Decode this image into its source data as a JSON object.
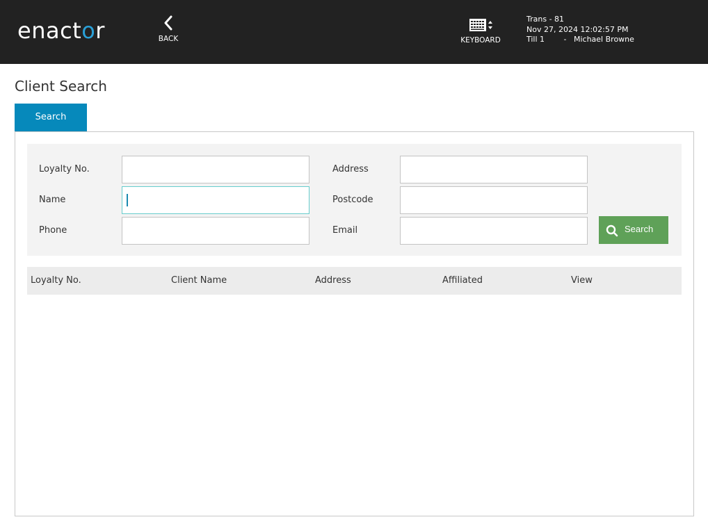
{
  "header": {
    "logo_text": "enactor",
    "back_label": "BACK",
    "keyboard_label": "KEYBOARD",
    "transaction": "Trans - 81",
    "datetime": "Nov 27, 2024 12:02:57 PM",
    "till": "Till 1",
    "separator": "-",
    "operator": "Michael Browne"
  },
  "page": {
    "title": "Client Search",
    "tabs": [
      {
        "label": "Search",
        "active": true
      }
    ]
  },
  "form": {
    "fields": [
      {
        "label": "Loyalty No.",
        "value": ""
      },
      {
        "label": "Name",
        "value": "",
        "focused": true
      },
      {
        "label": "Phone",
        "value": ""
      },
      {
        "label": "Address",
        "value": ""
      },
      {
        "label": "Postcode",
        "value": ""
      },
      {
        "label": "Email",
        "value": ""
      }
    ],
    "search_button_label": "Search"
  },
  "results_table": {
    "columns": [
      "Loyalty No.",
      "Client Name",
      "Address",
      "Affiliated",
      "View"
    ],
    "rows": []
  },
  "colors": {
    "topbar": "#222222",
    "tab_active": "#0689bb",
    "search_button": "#5fa158",
    "focus_border": "#66cccc",
    "logo_accent": "#2a9fd6"
  }
}
